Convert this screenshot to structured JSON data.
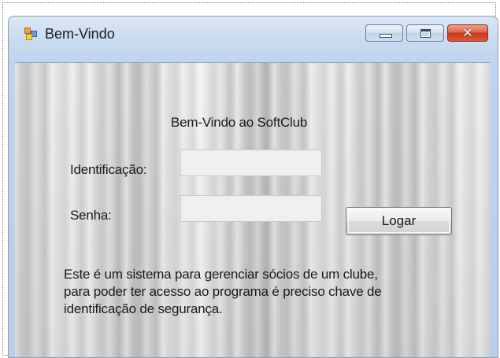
{
  "window": {
    "title": "Bem-Vindo",
    "controls": {
      "minimize_icon": "minimize-icon",
      "maximize_icon": "maximize-icon",
      "close_glyph": "✕"
    }
  },
  "form": {
    "welcome_text": "Bem-Vindo ao SoftClub",
    "identificacao_label": "Identificação:",
    "identificacao_value": "",
    "senha_label": "Senha:",
    "senha_value": "",
    "login_button_label": "Logar",
    "description_line1": "Este é um sistema para gerenciar sócios de um clube,",
    "description_line2": "para poder ter acesso ao programa é preciso chave de",
    "description_line3": "identificação de segurança."
  },
  "colors": {
    "close_button": "#d14a2a",
    "title_bar": "#c9dbf0"
  }
}
